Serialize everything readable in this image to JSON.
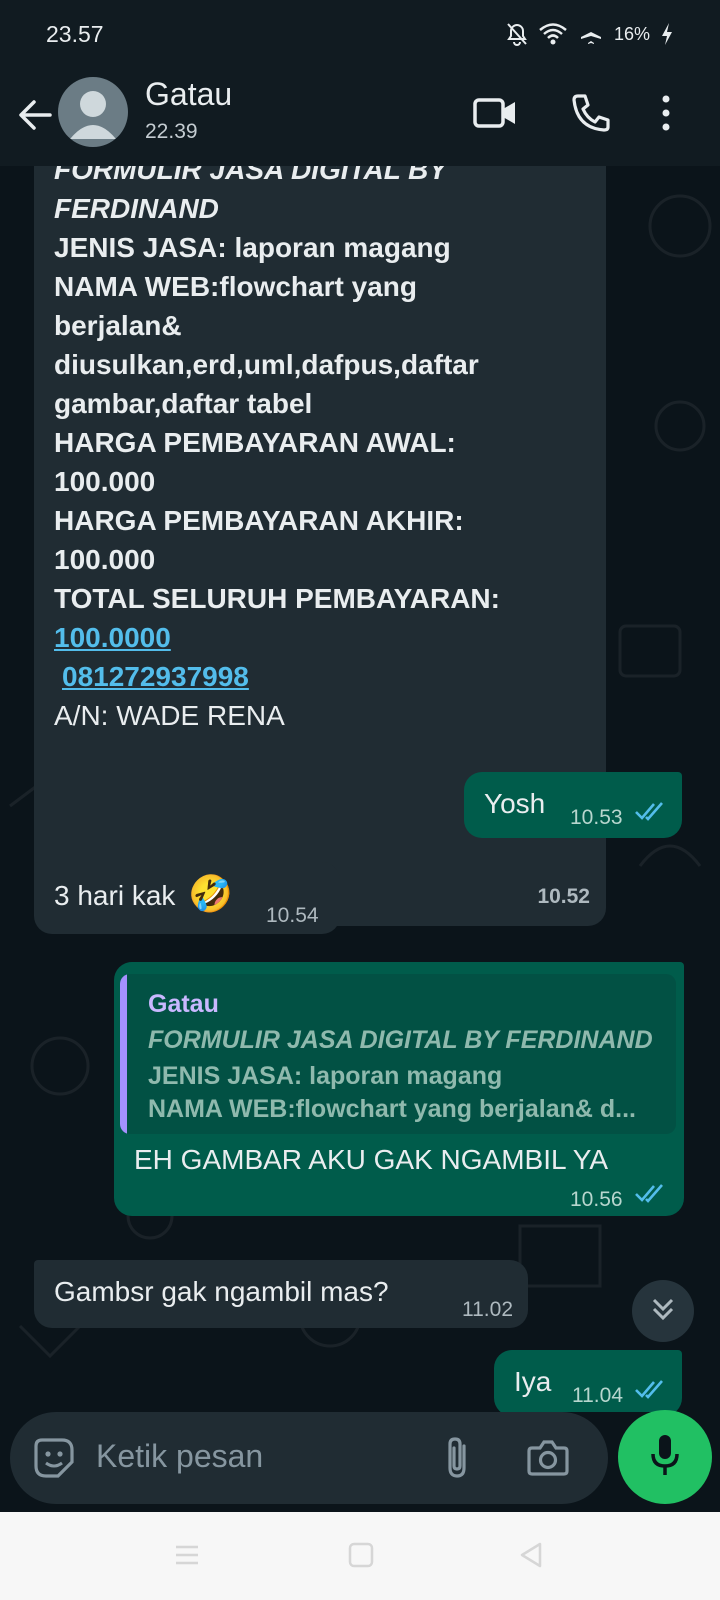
{
  "status_bar": {
    "time": "23.57",
    "battery": "16%"
  },
  "header": {
    "contact_name": "Gatau",
    "subtitle": "22.39"
  },
  "messages": {
    "big": {
      "line0": "FORMULIR JASA DIGITAL BY",
      "line1": "FERDINAND",
      "line2": "JENIS JASA: laporan magang",
      "line3": "NAMA WEB:flowchart yang",
      "line4": "berjalan&",
      "line5": "diusulkan,erd,uml,dafpus,daftar",
      "line6": "gambar,daftar tabel",
      "line7": "HARGA PEMBAYARAN AWAL:",
      "line8": "100.000",
      "line9": "HARGA PEMBAYARAN AKHIR:",
      "line10": "100.000",
      "line11": "TOTAL SELURUH PEMBAYARAN:",
      "link1": "100.0000",
      "link2": "081272937998",
      "line12": "A/N: WADE RENA",
      "time": "10.52"
    },
    "yosh": {
      "text": "Yosh",
      "time": "10.53"
    },
    "three_days": {
      "text": "3 hari kak",
      "emoji": "🤣",
      "time": "10.54"
    },
    "reply": {
      "quote_name": "Gatau",
      "quote_line1": "FORMULIR JASA DIGITAL BY FERDINAND",
      "quote_line2": "JENIS JASA: laporan magang",
      "quote_line3": "NAMA WEB:flowchart yang berjalan& d...",
      "text": "EH GAMBAR AKU GAK NGAMBIL YA",
      "time": "10.56"
    },
    "gambsr": {
      "text": "Gambsr gak ngambil mas?",
      "time": "11.02"
    },
    "iya": {
      "text": "Iya",
      "time": "11.04"
    }
  },
  "input": {
    "placeholder": "Ketik pesan"
  },
  "colors": {
    "background": "#0b141a",
    "incoming_bubble": "#202c33",
    "outgoing_bubble": "#005c4b",
    "link": "#53bdeb",
    "read_ticks": "#53bdeb",
    "mic_button": "#21c063"
  },
  "icons": [
    "back-arrow-icon",
    "video-call-icon",
    "phone-icon",
    "more-vert-icon",
    "emoji-icon",
    "attach-icon",
    "camera-icon",
    "mic-icon",
    "scroll-down-icon",
    "mute-icon",
    "wifi-icon",
    "airplane-icon",
    "battery-charging-icon"
  ]
}
